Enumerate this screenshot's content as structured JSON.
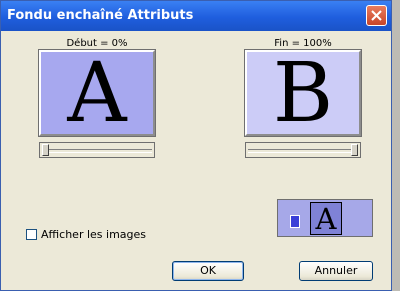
{
  "window": {
    "title": "Fondu enchaîné  Attributs"
  },
  "start": {
    "label": "Début = 0%",
    "letter": "A",
    "bg_color": "#a7a8ef",
    "slider_value_percent": 0
  },
  "end": {
    "label": "Fin = 100%",
    "letter": "B",
    "bg_color": "#ccccf7",
    "slider_value_percent": 100
  },
  "options": {
    "show_images_label": "Afficher les images",
    "show_images_checked": false
  },
  "mini_preview": {
    "letter": "A"
  },
  "buttons": {
    "ok": "OK",
    "cancel": "Annuler"
  },
  "icons": {
    "close": "close-icon",
    "mini": "swap-icon"
  }
}
